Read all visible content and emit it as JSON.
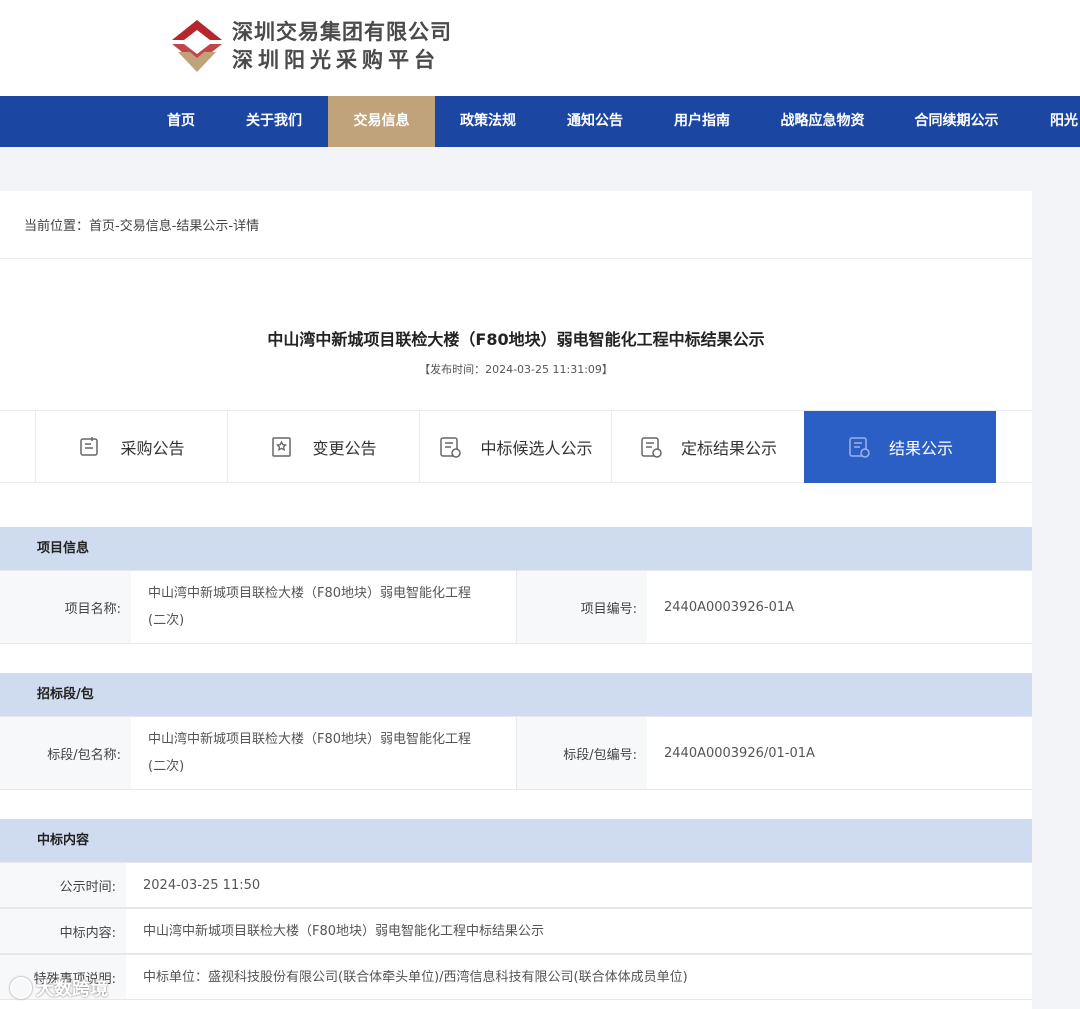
{
  "header": {
    "company_name": "深圳交易集团有限公司",
    "platform_name": "深圳阳光采购平台"
  },
  "nav": {
    "items": [
      {
        "label": "首页"
      },
      {
        "label": "关于我们"
      },
      {
        "label": "交易信息",
        "active": true
      },
      {
        "label": "政策法规"
      },
      {
        "label": "通知公告"
      },
      {
        "label": "用户指南"
      },
      {
        "label": "战略应急物资"
      },
      {
        "label": "合同续期公示"
      },
      {
        "label": "阳光"
      }
    ]
  },
  "breadcrumb": "当前位置：首页-交易信息-结果公示-详情",
  "notice": {
    "title": "中山湾中新城项目联检大楼（F80地块）弱电智能化工程中标结果公示",
    "publish_time": "【发布时间：2024-03-25 11:31:09】"
  },
  "tabs": [
    {
      "label": "采购公告",
      "icon": "document-icon"
    },
    {
      "label": "变更公告",
      "icon": "edit-document-icon"
    },
    {
      "label": "中标候选人公示",
      "icon": "list-document-icon"
    },
    {
      "label": "定标结果公示",
      "icon": "list-document-icon"
    },
    {
      "label": "结果公示",
      "icon": "result-document-icon",
      "active": true
    }
  ],
  "project_info": {
    "heading": "项目信息",
    "name_label": "项目名称:",
    "name_value_line1": "中山湾中新城项目联检大楼（F80地块）弱电智能化工程",
    "name_value_line2": "(二次)",
    "code_label": "项目编号:",
    "code_value": "2440A0003926-01A"
  },
  "bid_section": {
    "heading": "招标段/包",
    "name_label": "标段/包名称:",
    "name_value_line1": "中山湾中新城项目联检大楼（F80地块）弱电智能化工程",
    "name_value_line2": "(二次)",
    "code_label": "标段/包编号:",
    "code_value": "2440A0003926/01-01A"
  },
  "award": {
    "heading": "中标内容",
    "rows": [
      {
        "label": "公示时间:",
        "value": "2024-03-25 11:50"
      },
      {
        "label": "中标内容:",
        "value": "中山湾中新城项目联检大楼（F80地块）弱电智能化工程中标结果公示"
      },
      {
        "label": "特殊事项说明:",
        "value": "中标单位：盛视科技股份有限公司(联合体牵头单位)/西湾信息科技有限公司(联合体体成员单位)"
      }
    ]
  },
  "watermark": "大数跨境",
  "colors": {
    "nav_bg": "#1b47a3",
    "nav_active": "#c0a27b",
    "tab_active": "#2b5fc6",
    "section_head": "#cfdbee",
    "logo_red": "#b5262d",
    "logo_gold": "#c0a27b"
  }
}
